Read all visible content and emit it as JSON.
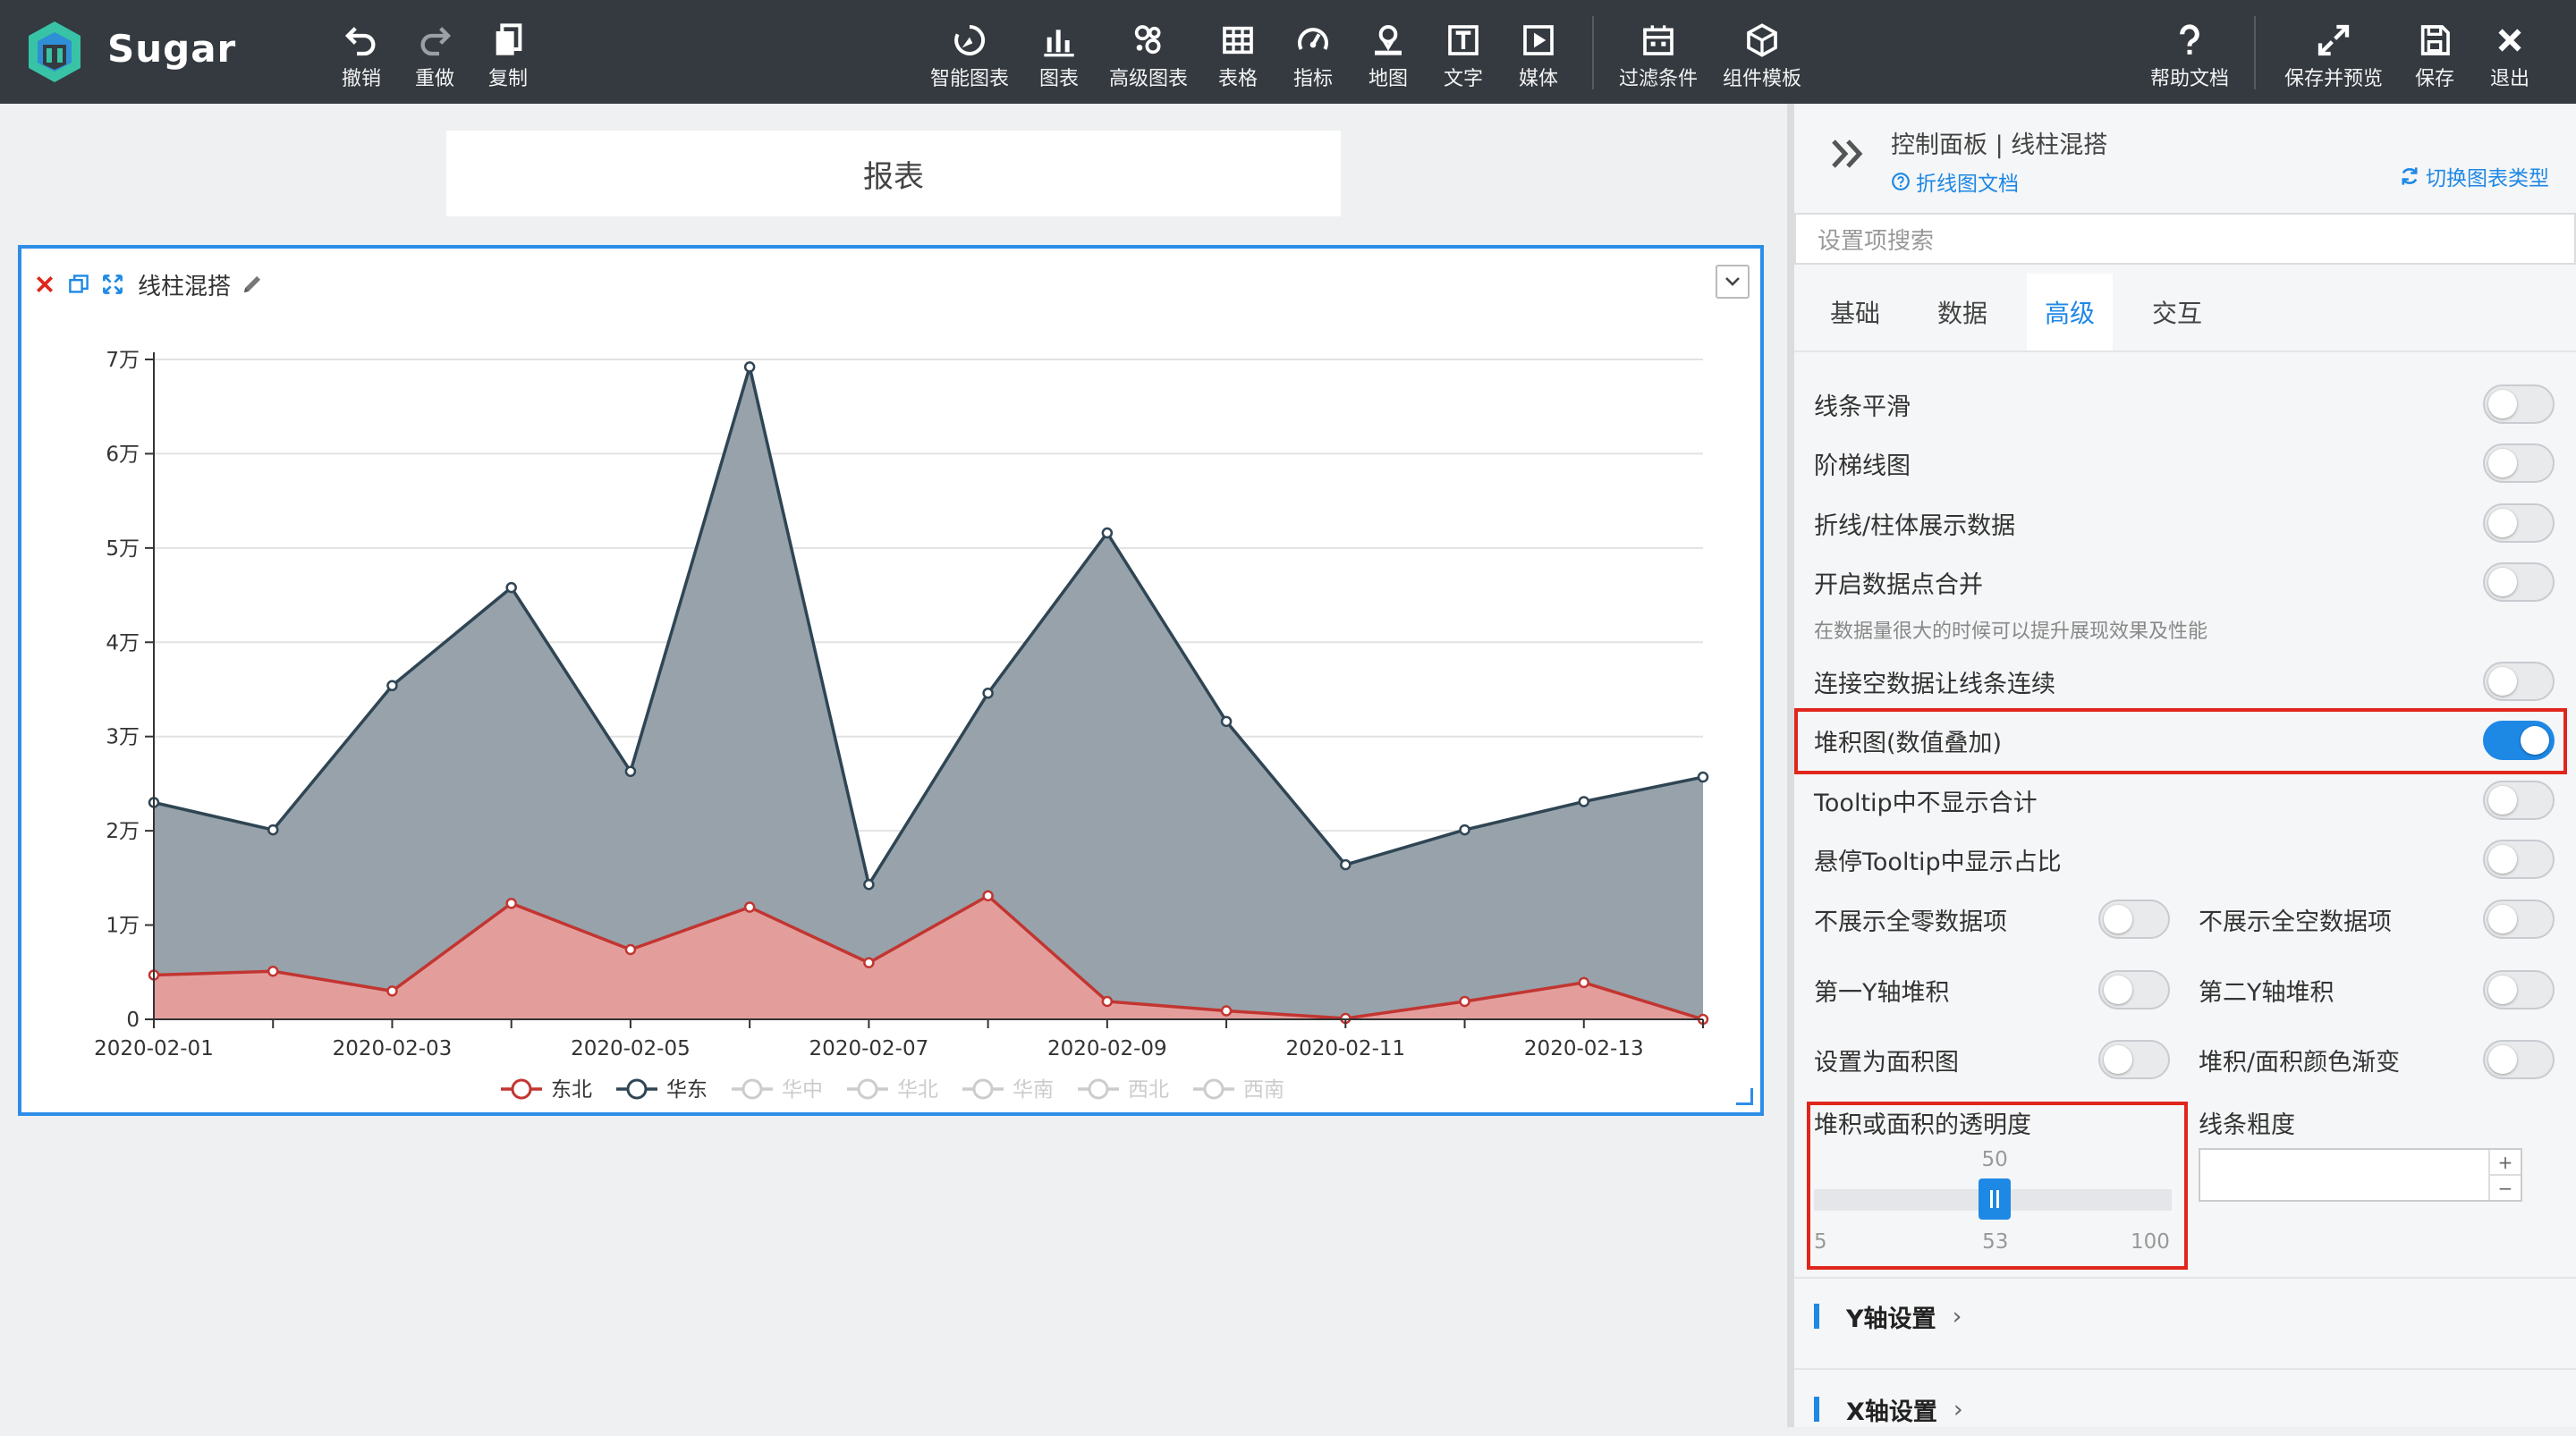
{
  "app": {
    "name": "Sugar",
    "brand_color": "#38c3a6"
  },
  "toolbar": {
    "left": [
      {
        "id": "undo",
        "label": "撤销",
        "icon": "undo-icon"
      },
      {
        "id": "redo",
        "label": "重做",
        "icon": "redo-icon"
      },
      {
        "id": "copy",
        "label": "复制",
        "icon": "copy-icon"
      }
    ],
    "center": [
      {
        "id": "smart-chart",
        "label": "智能图表",
        "icon": "smart-chart-icon"
      },
      {
        "id": "chart",
        "label": "图表",
        "icon": "bar-chart-icon"
      },
      {
        "id": "advanced-chart",
        "label": "高级图表",
        "icon": "advanced-chart-icon"
      },
      {
        "id": "table",
        "label": "表格",
        "icon": "table-icon"
      },
      {
        "id": "metric",
        "label": "指标",
        "icon": "gauge-icon"
      },
      {
        "id": "map",
        "label": "地图",
        "icon": "map-pin-icon"
      },
      {
        "id": "text",
        "label": "文字",
        "icon": "text-icon"
      },
      {
        "id": "media",
        "label": "媒体",
        "icon": "media-icon"
      }
    ],
    "center2": [
      {
        "id": "filter",
        "label": "过滤条件",
        "icon": "filter-calendar-icon"
      },
      {
        "id": "template",
        "label": "组件模板",
        "icon": "cube-icon"
      }
    ],
    "right": [
      {
        "id": "help",
        "label": "帮助文档",
        "icon": "question-icon"
      },
      {
        "id": "save-preview",
        "label": "保存并预览",
        "icon": "expand-icon"
      },
      {
        "id": "save",
        "label": "保存",
        "icon": "save-icon"
      },
      {
        "id": "exit",
        "label": "退出",
        "icon": "close-icon"
      }
    ]
  },
  "report": {
    "title": "报表"
  },
  "widget": {
    "title": "线柱混搭",
    "colors": {
      "east_north": "#c23531",
      "east": "#2f4554",
      "border": "#2d8ee8"
    }
  },
  "chart_data": {
    "type": "area",
    "stacked": true,
    "x": [
      "2020-02-01",
      "2020-02-02",
      "2020-02-03",
      "2020-02-04",
      "2020-02-05",
      "2020-02-06",
      "2020-02-07",
      "2020-02-08",
      "2020-02-09",
      "2020-02-10",
      "2020-02-11",
      "2020-02-12",
      "2020-02-13",
      "2020-02-14"
    ],
    "x_tick_labels": [
      "2020-02-01",
      "2020-02-03",
      "2020-02-05",
      "2020-02-07",
      "2020-02-09",
      "2020-02-11",
      "2020-02-13"
    ],
    "y_tick_labels": [
      "0",
      "1万",
      "2万",
      "3万",
      "4万",
      "5万",
      "6万",
      "7万"
    ],
    "ylim": [
      0,
      70000
    ],
    "grid": true,
    "legend_position": "bottom",
    "series": [
      {
        "name": "东北",
        "color": "#c23531",
        "fill": "#e39e9c",
        "visible": true,
        "values": [
          4700,
          5100,
          3000,
          12300,
          7400,
          11900,
          6000,
          13100,
          1900,
          900,
          100,
          1900,
          3900,
          0
        ]
      },
      {
        "name": "华东",
        "color": "#2f4554",
        "fill": "#97a2aa",
        "visible": true,
        "values": [
          18300,
          15000,
          32400,
          33500,
          18900,
          57300,
          8300,
          21500,
          49700,
          30700,
          16300,
          18200,
          19200,
          25700
        ]
      },
      {
        "name": "华中",
        "visible": false
      },
      {
        "name": "华北",
        "visible": false
      },
      {
        "name": "华南",
        "visible": false
      },
      {
        "name": "西北",
        "visible": false
      },
      {
        "name": "西南",
        "visible": false
      }
    ]
  },
  "panel": {
    "title": "控制面板 | 线柱混搭",
    "doc_link": "折线图文档",
    "switch_type": "切换图表类型",
    "search_placeholder": "设置项搜索",
    "tabs": [
      {
        "label": "基础",
        "active": false
      },
      {
        "label": "数据",
        "active": false
      },
      {
        "label": "高级",
        "active": true
      },
      {
        "label": "交互",
        "active": false
      }
    ],
    "options": {
      "smooth": {
        "label": "线条平滑",
        "on": false
      },
      "step": {
        "label": "阶梯线图",
        "on": false
      },
      "show_data": {
        "label": "折线/柱体展示数据",
        "on": false
      },
      "merge_points": {
        "label": "开启数据点合并",
        "on": false,
        "hint": "在数据量很大的时候可以提升展现效果及性能"
      },
      "connect_null": {
        "label": "连接空数据让线条连续",
        "on": false
      },
      "stack": {
        "label": "堆积图(数值叠加)",
        "on": true
      },
      "tooltip_no_total": {
        "label": "Tooltip中不显示合计",
        "on": false
      },
      "tooltip_percent": {
        "label": "悬停Tooltip中显示占比",
        "on": false
      },
      "hide_all_zero": {
        "label": "不展示全零数据项",
        "on": false
      },
      "hide_all_null": {
        "label": "不展示全空数据项",
        "on": false
      },
      "y1_stack": {
        "label": "第一Y轴堆积",
        "on": false
      },
      "y2_stack": {
        "label": "第二Y轴堆积",
        "on": false
      },
      "area": {
        "label": "设置为面积图",
        "on": false
      },
      "gradient": {
        "label": "堆积/面积颜色渐变",
        "on": false
      }
    },
    "opacity": {
      "label": "堆积或面积的透明度",
      "min": 5,
      "max": 100,
      "min_label": "5",
      "max_label": "100",
      "value": 53,
      "value_label": "53",
      "tip_label": "50"
    },
    "line_width": {
      "label": "线条粗度",
      "value": "",
      "plus": "+",
      "minus": "−"
    },
    "sections": [
      {
        "label": "Y轴设置"
      },
      {
        "label": "X轴设置"
      }
    ],
    "highlight_color": "#e0261c",
    "accent_color": "#1e88e5"
  }
}
